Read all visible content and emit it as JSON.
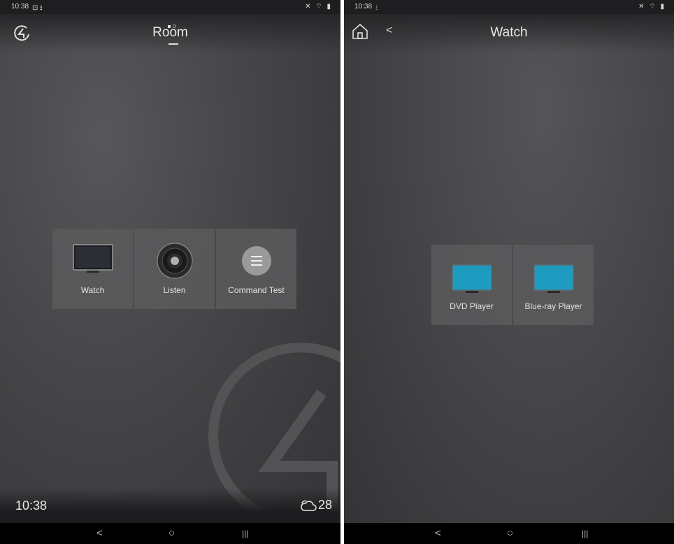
{
  "left_screen": {
    "status_time": "10:38",
    "status_icons_left": "⊡ ⭳",
    "status_icons_right": "✕ ⌔ ▮",
    "title": "Room",
    "logo_icon": "control4-logo-icon",
    "tiles": [
      {
        "label": "Watch",
        "icon": "tv-icon"
      },
      {
        "label": "Listen",
        "icon": "speaker-icon"
      },
      {
        "label": "Command Test",
        "icon": "list-icon"
      }
    ],
    "clock": "10:38",
    "weather_temp": "28",
    "weather_icon": "cloud-icon",
    "nav": {
      "back": "<",
      "home": "○",
      "recents": "|||"
    }
  },
  "right_screen": {
    "status_time": "10:38",
    "status_icons_left": "⭳",
    "status_icons_right": "✕ ⌔ ▮",
    "title": "Watch",
    "back_label": "<",
    "tiles": [
      {
        "label": "DVD Player",
        "icon": "tv-icon"
      },
      {
        "label": "Blue-ray Player",
        "icon": "tv-icon"
      }
    ],
    "nav": {
      "back": "<",
      "home": "○",
      "recents": "|||"
    }
  },
  "colors": {
    "background": "#3f3f41",
    "tile": "#5a5a5c",
    "screen_blue": "#1e9cc0",
    "text": "#e2e2e2"
  }
}
